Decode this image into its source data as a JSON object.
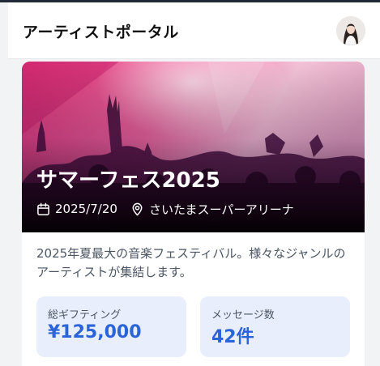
{
  "header": {
    "title": "アーティストポータル",
    "avatar_icon": "user-avatar-photo"
  },
  "event": {
    "title": "サマーフェス2025",
    "date": "2025/7/20",
    "date_icon": "calendar-icon",
    "venue": "さいたまスーパーアリーナ",
    "venue_icon": "map-pin-icon",
    "description": "2025年夏最大の音楽フェスティバル。様々なジャンルのアーティストが集結します。"
  },
  "stats": {
    "gifting_label": "総ギフティング",
    "gifting_value": "¥125,000",
    "messages_label": "メッセージ数",
    "messages_value": "42件"
  },
  "colors": {
    "accent": "#2b63d9",
    "stat_bg": "#e8eefb",
    "hero_pink": "#e0337a",
    "hero_purple": "#7b2a8a"
  }
}
